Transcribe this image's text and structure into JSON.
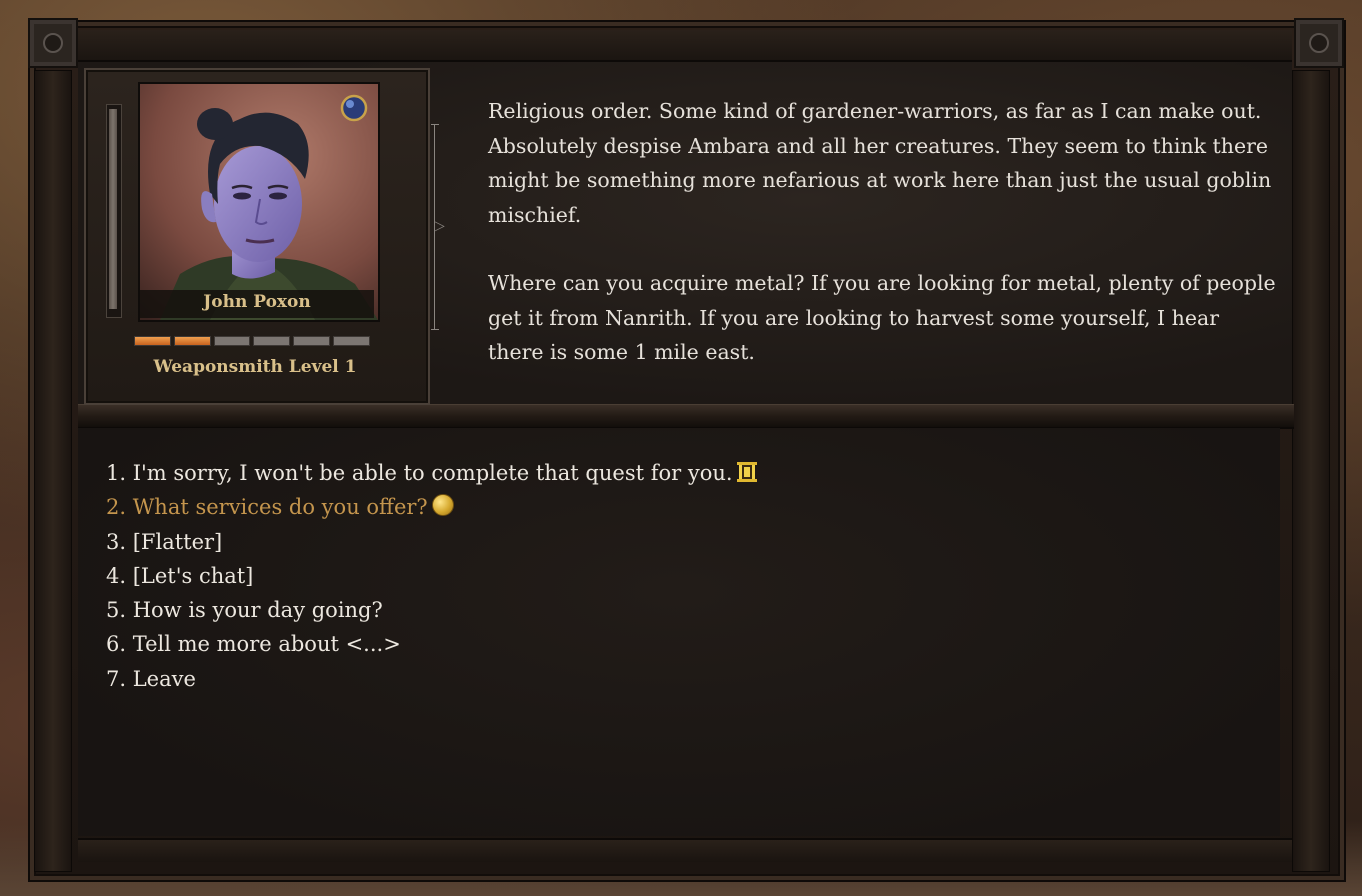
{
  "character": {
    "name": "John Poxon",
    "title": "Weaponsmith Level 1",
    "xp_segments_total": 6,
    "xp_segments_filled": 2
  },
  "npc_text": {
    "paragraph1": "Religious order. Some kind of gardener-warriors, as far as I can make out. Absolutely despise Ambara and all her creatures. They seem to think there might be something more nefarious at work here than just the usual goblin mischief.",
    "paragraph2": "Where can you acquire  metal? If you are looking for metal, plenty of people get it from Nanrith. If you are looking to harvest some yourself, I hear there is some 1 mile east."
  },
  "options": [
    {
      "label": "1. I'm sorry, I won't be able to complete that quest for you.",
      "icon": "quest-scroll-icon"
    },
    {
      "label": "2. What services do you offer?",
      "icon": "gold-coin-icon"
    },
    {
      "label": "3. [Flatter]"
    },
    {
      "label": "4. [Let's chat]"
    },
    {
      "label": "5. How is your day going?"
    },
    {
      "label": "6. Tell me more about <...>"
    },
    {
      "label": "7. Leave"
    }
  ],
  "colors": {
    "option_text": "#ece7df",
    "option_highlight": "#c4954d",
    "name_gold": "#d9c08a",
    "xp_orange": "#e8883a"
  }
}
